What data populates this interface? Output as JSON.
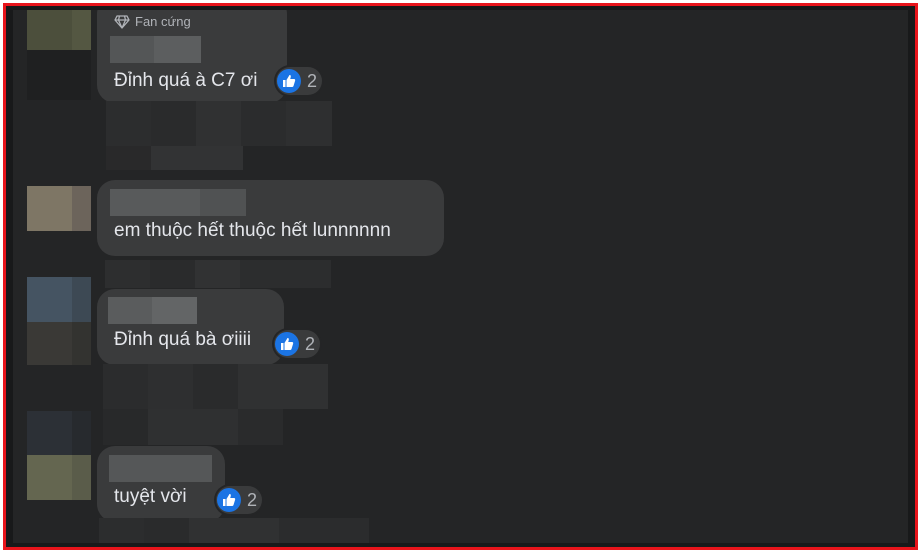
{
  "colors": {
    "frame_border": "#e8141b",
    "panel_bg": "#242526",
    "bubble_bg": "#3a3b3c",
    "text": "#e4e6eb",
    "muted_text": "#b0b3b8",
    "like_blue": "#1b74e4"
  },
  "comments": [
    {
      "badge": "Fan cứng",
      "badge_icon": "diamond-icon",
      "text": "Đỉnh quá à C7 ơi",
      "reactions": "2",
      "reaction_icon": "thumbs-up-icon"
    },
    {
      "text": "em thuộc hết thuộc hết lunnnnnn"
    },
    {
      "text": "Đỉnh quá bà ơiiii",
      "reactions": "2",
      "reaction_icon": "thumbs-up-icon"
    },
    {
      "text": "tuyệt vời",
      "reactions": "2",
      "reaction_icon": "thumbs-up-icon"
    }
  ]
}
